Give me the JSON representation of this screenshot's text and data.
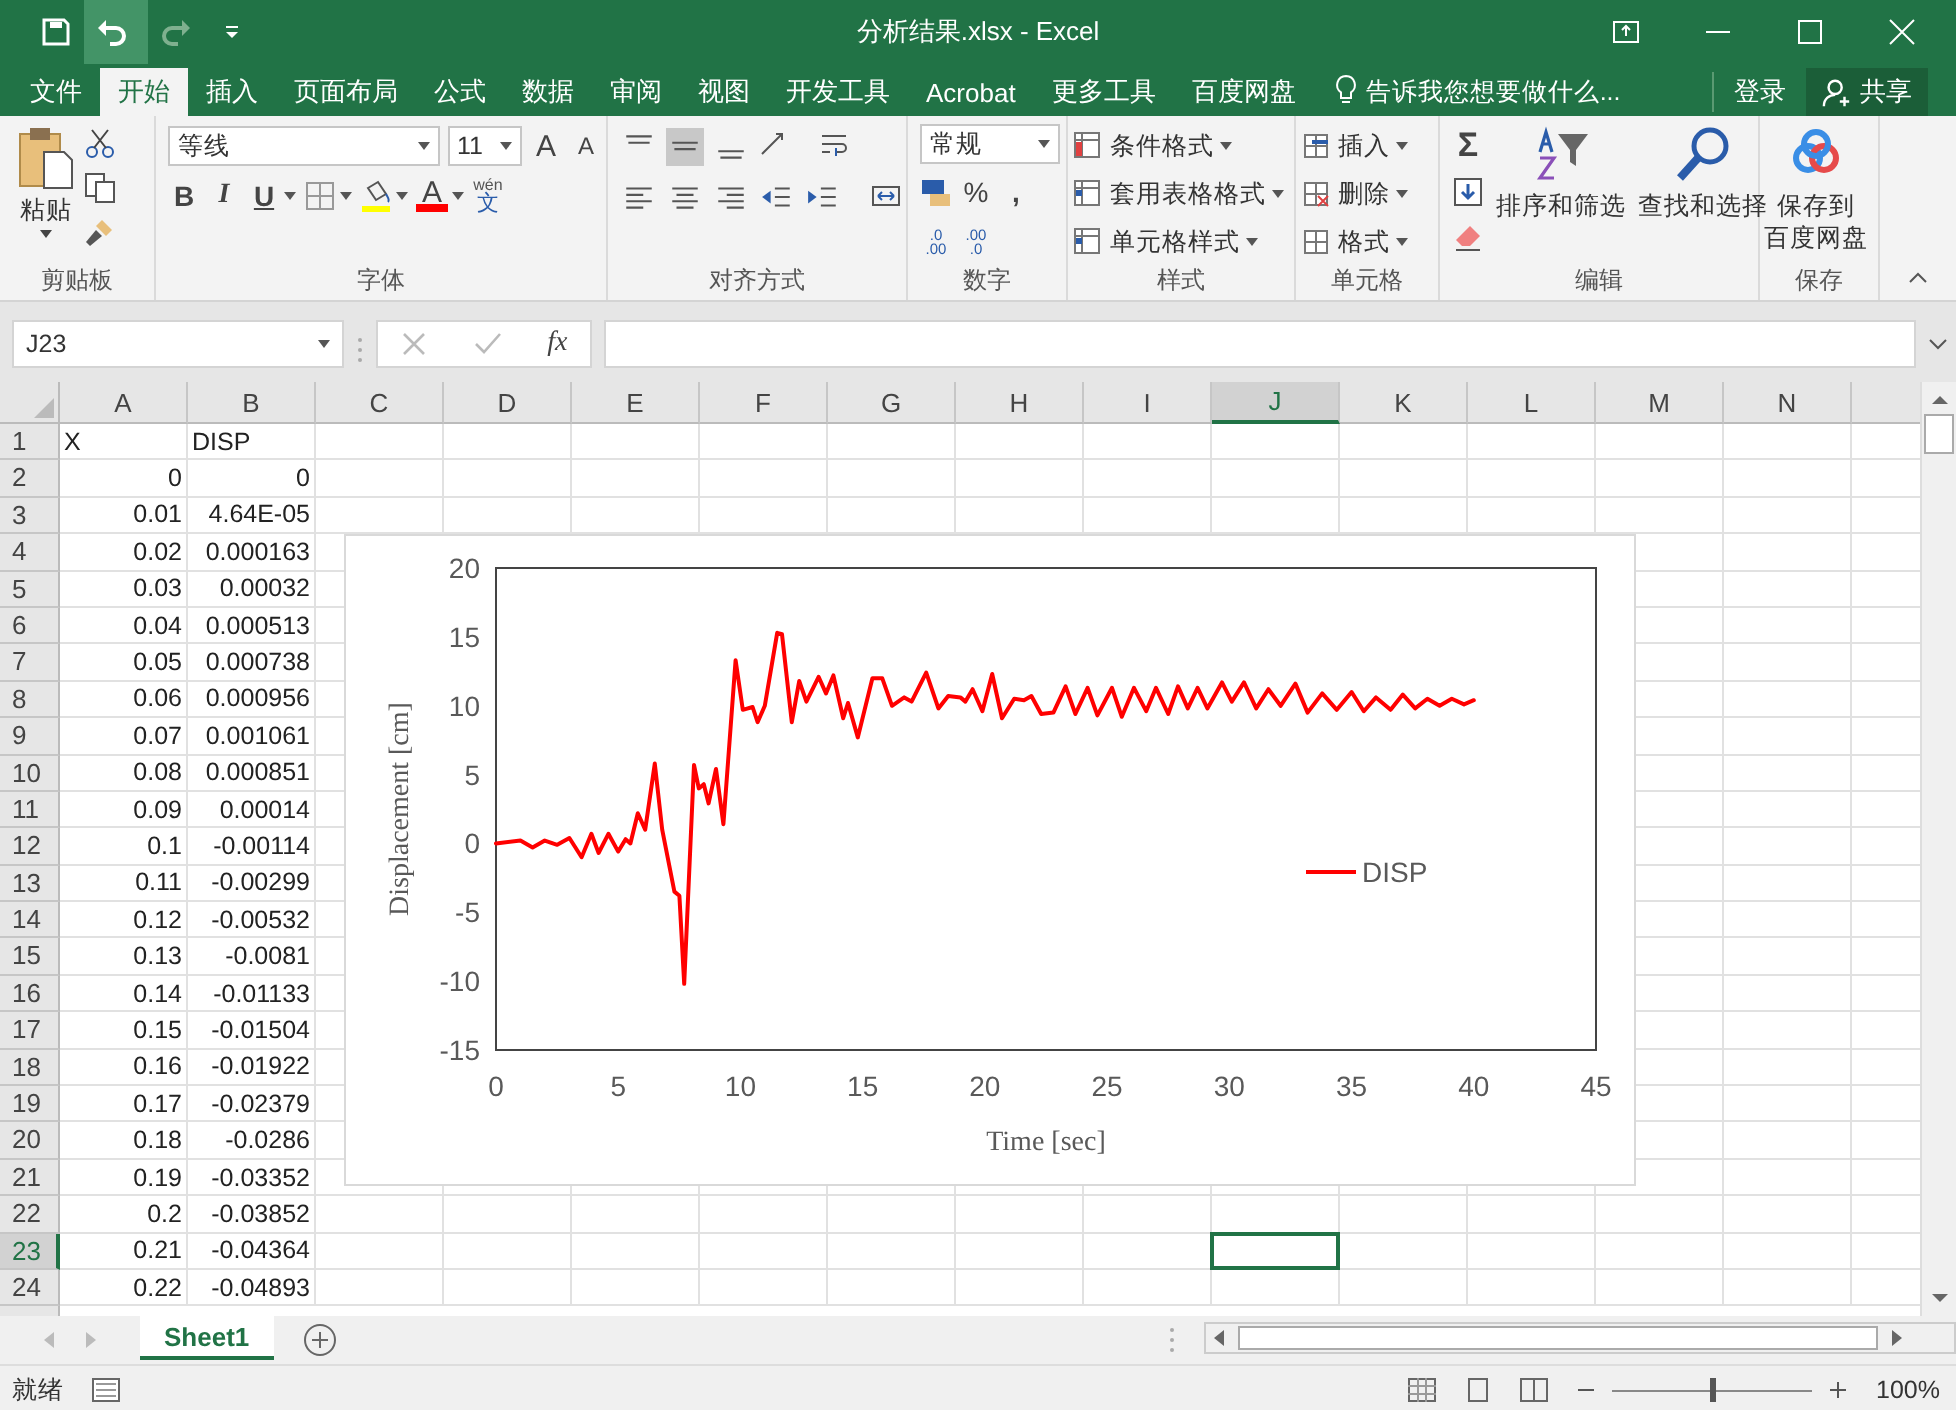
{
  "window": {
    "title": "分析结果.xlsx - Excel"
  },
  "tabs": [
    {
      "label": "文件",
      "selected": false
    },
    {
      "label": "开始",
      "selected": true
    },
    {
      "label": "插入",
      "selected": false
    },
    {
      "label": "页面布局",
      "selected": false
    },
    {
      "label": "公式",
      "selected": false
    },
    {
      "label": "数据",
      "selected": false
    },
    {
      "label": "审阅",
      "selected": false
    },
    {
      "label": "视图",
      "selected": false
    },
    {
      "label": "开发工具",
      "selected": false
    },
    {
      "label": "Acrobat",
      "selected": false
    },
    {
      "label": "更多工具",
      "selected": false
    },
    {
      "label": "百度网盘",
      "selected": false
    }
  ],
  "tell_me": {
    "placeholder": "告诉我您想要做什么..."
  },
  "sign_in": "登录",
  "share": "共享",
  "ribbon": {
    "clipboard": {
      "label": "剪贴板",
      "paste": "粘贴"
    },
    "font": {
      "label": "字体",
      "font_name": "等线",
      "font_size": "11",
      "grow": "A",
      "shrink": "A",
      "bold": "B",
      "italic": "I",
      "underline": "U",
      "font_color": "A",
      "phonetic": {
        "ruby": "wén",
        "char": "文"
      }
    },
    "alignment": {
      "label": "对齐方式"
    },
    "number": {
      "label": "数字",
      "format": "常规",
      "percent": "%",
      "comma": ",",
      "decimals": [
        {
          "top": ".0",
          "bottom": ".00"
        },
        {
          "top": ".00",
          "bottom": ".0"
        }
      ]
    },
    "styles": {
      "label": "样式",
      "items": [
        "条件格式",
        "套用表格格式",
        "单元格样式"
      ]
    },
    "cells": {
      "label": "单元格",
      "items": [
        "插入",
        "删除",
        "格式"
      ]
    },
    "editing": {
      "label": "编辑",
      "autosum": "Σ",
      "sort": "排序和筛选",
      "find": "查找和选择"
    },
    "save": {
      "label": "保存",
      "button": [
        "保存到",
        "百度网盘"
      ]
    }
  },
  "formula_bar": {
    "name_box": "J23",
    "function": "fx"
  },
  "sheet": {
    "columns": [
      {
        "label": "A",
        "selected": false
      },
      {
        "label": "B",
        "selected": false
      },
      {
        "label": "C",
        "selected": false
      },
      {
        "label": "D",
        "selected": false
      },
      {
        "label": "E",
        "selected": false
      },
      {
        "label": "F",
        "selected": false
      },
      {
        "label": "G",
        "selected": false
      },
      {
        "label": "H",
        "selected": false
      },
      {
        "label": "I",
        "selected": false
      },
      {
        "label": "J",
        "selected": true
      },
      {
        "label": "K",
        "selected": false
      },
      {
        "label": "L",
        "selected": false
      },
      {
        "label": "M",
        "selected": false
      },
      {
        "label": "N",
        "selected": false
      }
    ],
    "rows": [
      {
        "number": "1",
        "kind": "text",
        "cells": [
          "X",
          "DISP"
        ],
        "selected": false
      },
      {
        "number": "2",
        "kind": "number",
        "cells": [
          "0",
          "0"
        ],
        "selected": false
      },
      {
        "number": "3",
        "kind": "number",
        "cells": [
          "0.01",
          "4.64E-05"
        ],
        "selected": false
      },
      {
        "number": "4",
        "kind": "number",
        "cells": [
          "0.02",
          "0.000163"
        ],
        "selected": false
      },
      {
        "number": "5",
        "kind": "number",
        "cells": [
          "0.03",
          "0.00032"
        ],
        "selected": false
      },
      {
        "number": "6",
        "kind": "number",
        "cells": [
          "0.04",
          "0.000513"
        ],
        "selected": false
      },
      {
        "number": "7",
        "kind": "number",
        "cells": [
          "0.05",
          "0.000738"
        ],
        "selected": false
      },
      {
        "number": "8",
        "kind": "number",
        "cells": [
          "0.06",
          "0.000956"
        ],
        "selected": false
      },
      {
        "number": "9",
        "kind": "number",
        "cells": [
          "0.07",
          "0.001061"
        ],
        "selected": false
      },
      {
        "number": "10",
        "kind": "number",
        "cells": [
          "0.08",
          "0.000851"
        ],
        "selected": false
      },
      {
        "number": "11",
        "kind": "number",
        "cells": [
          "0.09",
          "0.00014"
        ],
        "selected": false
      },
      {
        "number": "12",
        "kind": "number",
        "cells": [
          "0.1",
          "-0.00114"
        ],
        "selected": false
      },
      {
        "number": "13",
        "kind": "number",
        "cells": [
          "0.11",
          "-0.00299"
        ],
        "selected": false
      },
      {
        "number": "14",
        "kind": "number",
        "cells": [
          "0.12",
          "-0.00532"
        ],
        "selected": false
      },
      {
        "number": "15",
        "kind": "number",
        "cells": [
          "0.13",
          "-0.0081"
        ],
        "selected": false
      },
      {
        "number": "16",
        "kind": "number",
        "cells": [
          "0.14",
          "-0.01133"
        ],
        "selected": false
      },
      {
        "number": "17",
        "kind": "number",
        "cells": [
          "0.15",
          "-0.01504"
        ],
        "selected": false
      },
      {
        "number": "18",
        "kind": "number",
        "cells": [
          "0.16",
          "-0.01922"
        ],
        "selected": false
      },
      {
        "number": "19",
        "kind": "number",
        "cells": [
          "0.17",
          "-0.02379"
        ],
        "selected": false
      },
      {
        "number": "20",
        "kind": "number",
        "cells": [
          "0.18",
          "-0.0286"
        ],
        "selected": false
      },
      {
        "number": "21",
        "kind": "number",
        "cells": [
          "0.19",
          "-0.03352"
        ],
        "selected": false
      },
      {
        "number": "22",
        "kind": "number",
        "cells": [
          "0.2",
          "-0.03852"
        ],
        "selected": false
      },
      {
        "number": "23",
        "kind": "number",
        "cells": [
          "0.21",
          "-0.04364"
        ],
        "selected": true
      },
      {
        "number": "24",
        "kind": "number",
        "cells": [
          "0.22",
          "-0.04893"
        ],
        "selected": false
      }
    ]
  },
  "chart": {
    "chart_data": {
      "type": "line",
      "xlabel": "Time [sec]",
      "ylabel": "Displacement [cm]",
      "xlim": [
        0,
        45
      ],
      "ylim": [
        -15,
        20
      ],
      "xticks": [
        0,
        5,
        10,
        15,
        20,
        25,
        30,
        35,
        40,
        45
      ],
      "yticks": [
        -15,
        -10,
        -5,
        0,
        5,
        10,
        15,
        20
      ],
      "x": [
        0,
        1,
        1.5,
        2,
        2.5,
        3,
        3.5,
        3.9,
        4.2,
        4.6,
        5,
        5.3,
        5.5,
        5.8,
        6.1,
        6.5,
        6.8,
        7.3,
        7.5,
        7.7,
        8.1,
        8.3,
        8.5,
        8.7,
        9,
        9.3,
        9.8,
        10.1,
        10.5,
        10.7,
        11,
        11.5,
        11.7,
        12.1,
        12.4,
        12.7,
        13.2,
        13.5,
        13.8,
        14.2,
        14.4,
        14.8,
        15.4,
        15.8,
        16.2,
        16.7,
        17,
        17.6,
        18.1,
        18.5,
        19,
        19.2,
        19.5,
        19.9,
        20.3,
        20.7,
        21.2,
        21.6,
        21.9,
        22.3,
        22.8,
        23.3,
        23.7,
        24.2,
        24.6,
        25.2,
        25.6,
        26.1,
        26.6,
        27,
        27.5,
        27.9,
        28.3,
        28.7,
        29.1,
        29.7,
        30.1,
        30.6,
        31.1,
        31.6,
        32.1,
        32.7,
        33.2,
        33.8,
        34.4,
        35,
        35.5,
        36,
        36.6,
        37.1,
        37.6,
        38.1,
        38.6,
        39.1,
        39.6,
        40
      ],
      "series": [
        {
          "name": "DISP",
          "color": "#ff0000",
          "values": [
            0,
            0.2,
            -0.3,
            0.2,
            -0.1,
            0.4,
            -1,
            0.7,
            -0.7,
            0.7,
            -0.6,
            0.3,
            0,
            2.2,
            1,
            5.8,
            1,
            -3.5,
            -3.8,
            -10.2,
            5.7,
            4,
            4.3,
            2.9,
            5.4,
            1.4,
            13.3,
            9.7,
            9.9,
            8.8,
            10,
            15.3,
            15.2,
            8.8,
            11.8,
            10.3,
            12.1,
            10.9,
            12.2,
            9.1,
            10.2,
            7.7,
            12,
            12,
            10,
            10.6,
            10.3,
            12.4,
            9.8,
            10.7,
            10.6,
            10.3,
            11.2,
            9.6,
            12.3,
            9.1,
            10.5,
            10.4,
            10.7,
            9.4,
            9.5,
            11.4,
            9.4,
            11.3,
            9.3,
            11.3,
            9.2,
            11.3,
            9.6,
            11.3,
            9.4,
            11.4,
            9.8,
            11.3,
            9.8,
            11.7,
            10.3,
            11.7,
            9.8,
            11.2,
            10,
            11.6,
            9.5,
            10.9,
            9.7,
            11,
            9.6,
            10.6,
            9.7,
            10.8,
            9.8,
            10.5,
            10,
            10.5,
            10.1,
            10.4
          ]
        }
      ]
    }
  },
  "sheet_tabs": [
    {
      "label": "Sheet1",
      "selected": true
    }
  ],
  "status_bar": {
    "status": "就绪",
    "zoom": "100%",
    "zoom_slider": {
      "level": 0.5
    }
  }
}
